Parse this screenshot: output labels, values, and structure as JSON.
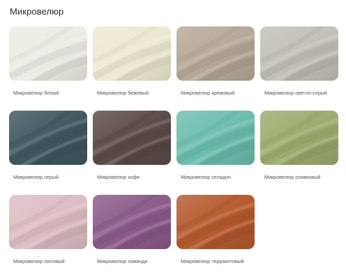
{
  "section_title": "Микровелюр",
  "swatches": [
    {
      "label": "Микровелюр белый",
      "color": "#ECECE4"
    },
    {
      "label": "Микровелюр бежевый",
      "color": "#EEE9D0"
    },
    {
      "label": "Микровелюр кремовый",
      "color": "#B5A898"
    },
    {
      "label": "Микровелюр светло-серый",
      "color": "#C2BFB6"
    },
    {
      "label": "Микровелюр серый",
      "color": "#3E575D"
    },
    {
      "label": "Микровелюр кофе",
      "color": "#5B4A47"
    },
    {
      "label": "Микровелюр селадон",
      "color": "#6CBDAE"
    },
    {
      "label": "Микровелюр оливковый",
      "color": "#9CAB6E"
    },
    {
      "label": "Микровелюр лиловый",
      "color": "#DDBDC3"
    },
    {
      "label": "Микровелюр лаванда",
      "color": "#8B5A89"
    },
    {
      "label": "Микровелюр терракотовый",
      "color": "#B55A2E"
    }
  ]
}
